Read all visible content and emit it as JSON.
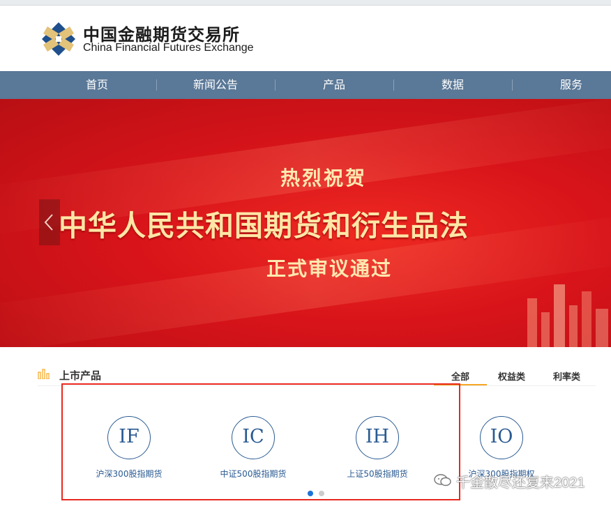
{
  "header": {
    "logo_cn": "中国金融期货交易所",
    "logo_en": "China Financial Futures Exchange"
  },
  "nav": {
    "items": [
      "首页",
      "新闻公告",
      "产品",
      "数据",
      "服务"
    ]
  },
  "banner": {
    "line1": "热烈祝贺",
    "line2": "中华人民共和国期货和衍生品法",
    "line3": "正式审议通过"
  },
  "section": {
    "title": "上市产品",
    "tabs": [
      "全部",
      "权益类",
      "利率类"
    ],
    "active_tab": "全部"
  },
  "products": [
    {
      "code": "IF",
      "name": "沪深300股指期货"
    },
    {
      "code": "IC",
      "name": "中证500股指期货"
    },
    {
      "code": "IH",
      "name": "上证50股指期货"
    },
    {
      "code": "IO",
      "name": "沪深300股指期权"
    }
  ],
  "carousel": {
    "pages": 2,
    "active": 1
  },
  "watermark": {
    "text": "千金散尽还复来2021"
  },
  "colors": {
    "nav": "#5a7897",
    "banner": "#d8141a",
    "accent_tab": "#f5a623",
    "product": "#2a5a92",
    "highlight_box": "#e8281e"
  }
}
